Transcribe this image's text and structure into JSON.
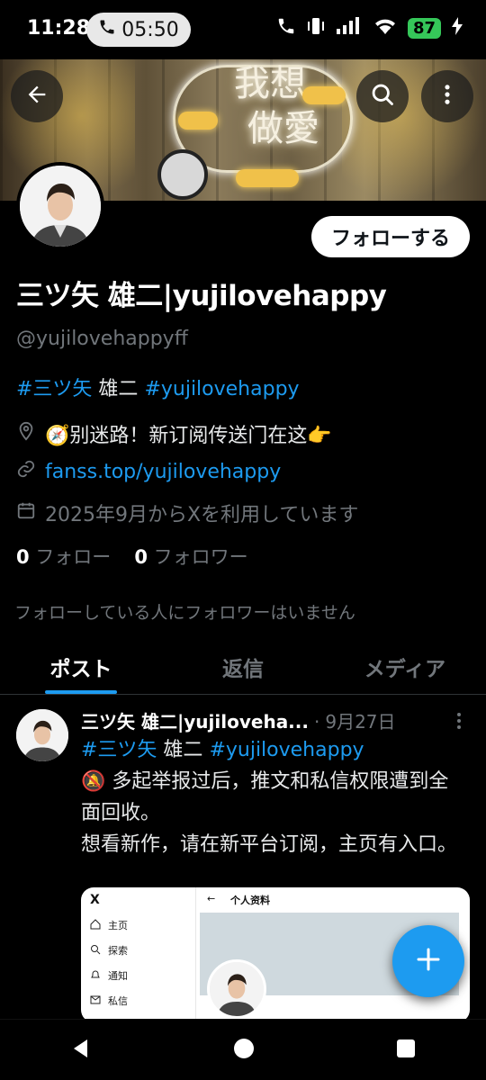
{
  "status_bar": {
    "time": "11:28",
    "call_timer": "05:50",
    "battery": "87"
  },
  "banner": {
    "neon_line1": "我想",
    "neon_line2": "做愛"
  },
  "profile": {
    "follow_label": "フォローする",
    "display_name": "三ツ矢 雄二|yujilovehappy",
    "handle": "@yujilovehappyff",
    "bio_tag1": "#三ツ矢",
    "bio_plain": " 雄二 ",
    "bio_tag2": "#yujilovehappy",
    "location": "🧭别迷路！新订阅传送门在这👉",
    "website": "fanss.top/yujilovehappy",
    "joined": "2025年9月からXを利用しています",
    "following_count": "0",
    "following_label": "フォロー",
    "followers_count": "0",
    "followers_label": "フォロワー",
    "notice": "フォローしている人にフォロワーはいません"
  },
  "tabs": [
    {
      "label": "ポスト",
      "active": true
    },
    {
      "label": "返信",
      "active": false
    },
    {
      "label": "メディア",
      "active": false
    }
  ],
  "post": {
    "author": "三ツ矢 雄二|yujilovehа...",
    "separator": "·",
    "date": "9月27日",
    "tag1": "#三ツ矢",
    "plain": " 雄二 ",
    "tag2": "#yujilovehappy",
    "line1": "🔕 多起举报过后，推文和私信权限遭到全面回收。",
    "line2": "想看新作，请在新平台订阅，主页有入口。"
  },
  "media": {
    "header": "个人资料",
    "back_arrow": "←",
    "logo": "X",
    "menu": [
      "主页",
      "探索",
      "通知",
      "私信"
    ]
  },
  "colors": {
    "accent": "#1d9bf0",
    "muted": "#71767b",
    "background": "#000000"
  }
}
